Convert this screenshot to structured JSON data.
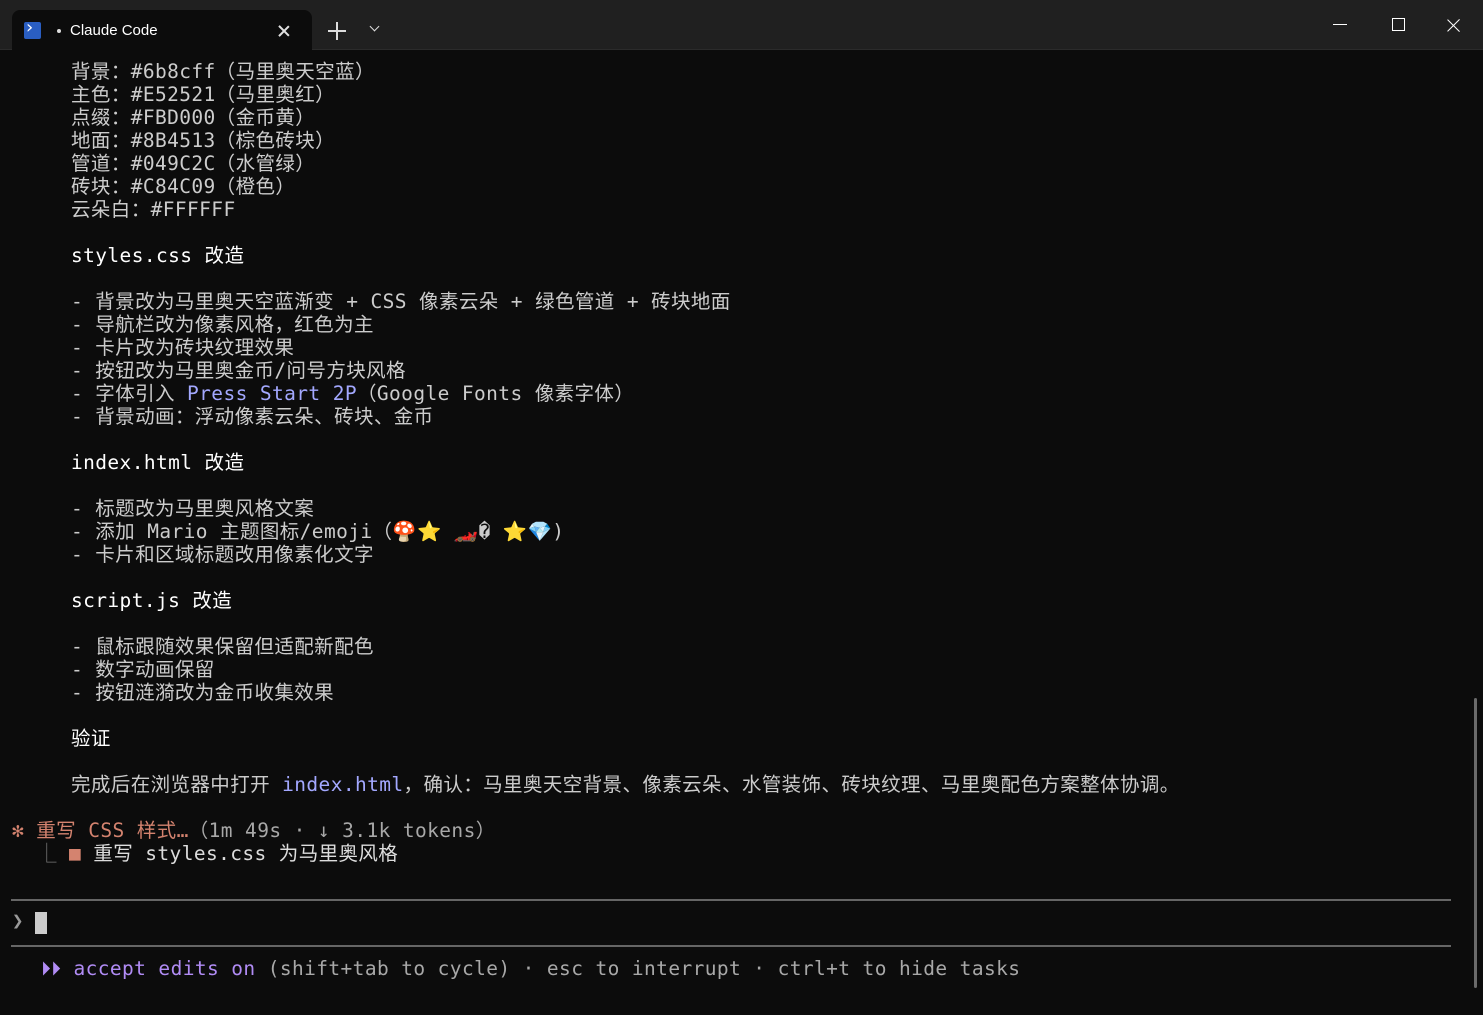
{
  "tab": {
    "title": "Claude Code"
  },
  "lines": {
    "l1": "背景：#6b8cff（马里奥天空蓝）",
    "l2": "主色：#E52521（马里奥红）",
    "l3": "点缀：#FBD000（金币黄）",
    "l4": "地面：#8B4513（棕色砖块）",
    "l5": "管道：#049C2C（水管绿）",
    "l6": "砖块：#C84C09（橙色）",
    "l7": "云朵白：#FFFFFF",
    "h_css": "styles.css 改造",
    "css1": "- 背景改为马里奥天空蓝渐变 + CSS 像素云朵 + 绿色管道 + 砖块地面",
    "css2": "- 导航栏改为像素风格，红色为主",
    "css3": "- 卡片改为砖块纹理效果",
    "css4": "- 按钮改为马里奥金币/问号方块风格",
    "css5_a": "- 字体引入 ",
    "css5_link": "Press Start 2P",
    "css5_b": "（Google Fonts 像素字体）",
    "css6": "- 背景动画：浮动像素云朵、砖块、金币",
    "h_html": "index.html 改造",
    "html1": "- 标题改为马里奥风格文案",
    "html2": "- 添加 Mario 主题图标/emoji（🍄⭐ 🏎️� ⭐💎)",
    "html3": "- 卡片和区域标题改用像素化文字",
    "h_js": "script.js 改造",
    "js1": "- 鼠标跟随效果保留但适配新配色",
    "js2": "- 数字动画保留",
    "js3": "- 按钮涟漪改为金币收集效果",
    "h_verify": "验证",
    "verify_a": "完成后在浏览器中打开 ",
    "verify_link": "index.html",
    "verify_b": "，确认：马里奥天空背景、像素云朵、水管装饰、砖块纹理、马里奥配色方案整体协调。"
  },
  "status": {
    "spinner": "✻",
    "label": "重写 CSS 样式…",
    "meta": "（1m 49s · ↓ 3.1k tokens）"
  },
  "task": {
    "branch": "⎿",
    "marker": "■",
    "label": "重写 styles.css 为马里奥风格"
  },
  "prompt": {
    "symbol": "❯"
  },
  "footer": {
    "arrows": "⏵⏵",
    "mode": "accept edits on",
    "hint": " (shift+tab to cycle) · esc to interrupt · ctrl+t to hide tasks"
  }
}
